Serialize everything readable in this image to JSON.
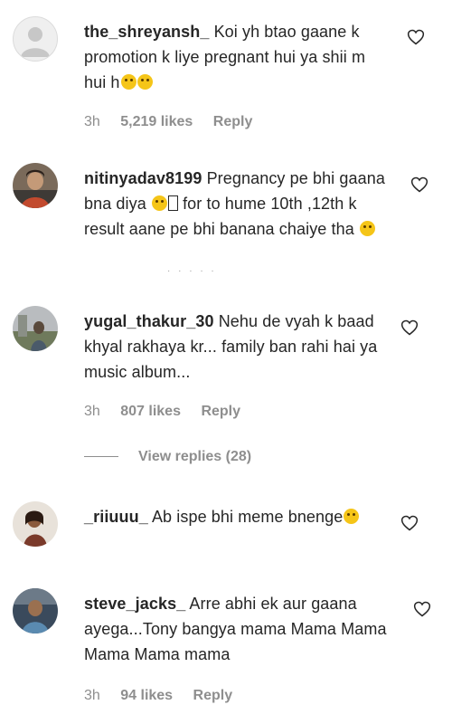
{
  "comments": [
    {
      "username": "the_shreyansh_",
      "text": "Koi yh btao gaane k promotion k liye pregnant hui ya shii m hui h",
      "emojis": [
        "neutral-face",
        "grinning-face"
      ],
      "time": "3h",
      "likes": "5,219 likes",
      "reply": "Reply",
      "avatar": "default-avatar"
    },
    {
      "username": "nitinyadav8199",
      "text": "Pregnancy pe bhi gaana bna diya",
      "text_cont": " for to hume 10th ,12th k result aane pe bhi banana chaiye tha",
      "emojis": [
        "tongue-face",
        "grinning-face"
      ],
      "avatar": "photo-avatar"
    },
    {
      "username": "yugal_thakur_30",
      "text": "Nehu de vyah k baad khyal rakhaya kr... family ban rahi hai ya music album...",
      "time": "3h",
      "likes": "807 likes",
      "reply": "Reply",
      "avatar": "photo-avatar",
      "view_replies": "View replies (28)"
    },
    {
      "username": "_riiuuu_",
      "text": "Ab ispe bhi meme bnenge",
      "emojis": [
        "grinning-face"
      ],
      "avatar": "photo-avatar"
    },
    {
      "username": "steve_jacks_",
      "text": "Arre abhi ek aur gaana ayega...Tony bangya mama Mama Mama Mama Mama mama",
      "time": "3h",
      "likes": "94 likes",
      "reply": "Reply",
      "avatar": "photo-avatar"
    }
  ],
  "colors": {
    "text": "#262626",
    "meta": "#8e8e8e",
    "emoji": "#f5c518"
  }
}
